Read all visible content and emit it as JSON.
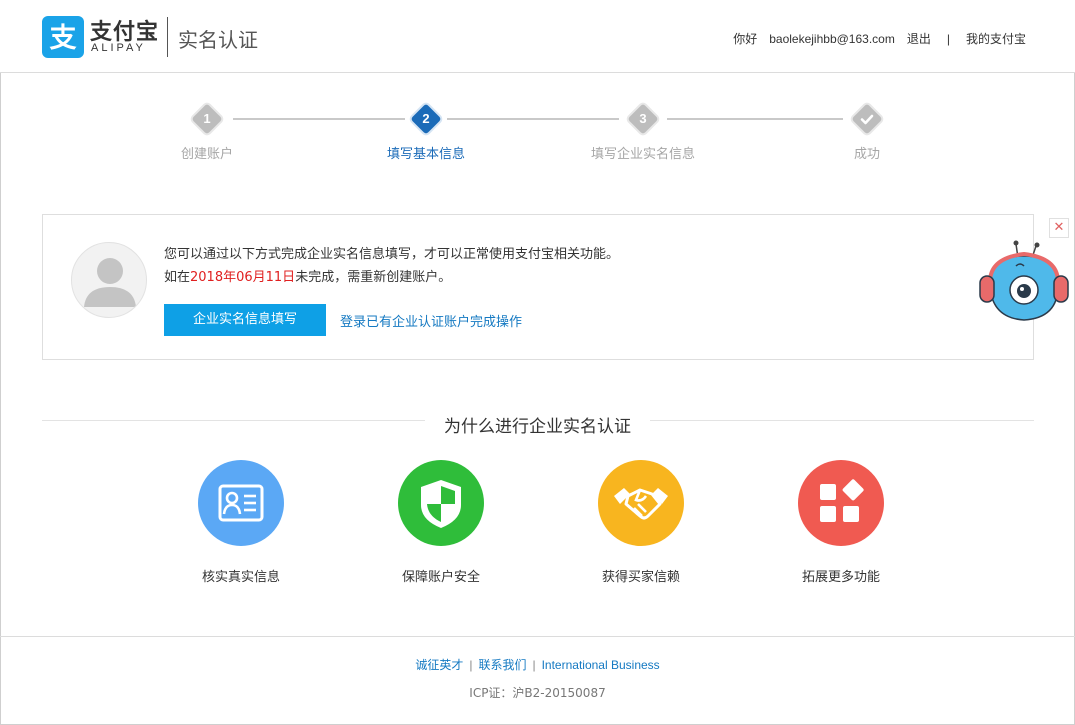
{
  "header": {
    "logo_text": "支付宝",
    "logo_sub": "ALIPAY",
    "title": "实名认证",
    "user": {
      "greeting": "你好",
      "email": "baolekejihbb@163.com",
      "logout": "退出",
      "separator": "|",
      "my_alipay": "我的支付宝"
    }
  },
  "steps": [
    {
      "num": "1",
      "label": "创建账户",
      "state": "done"
    },
    {
      "num": "2",
      "label": "填写基本信息",
      "state": "active"
    },
    {
      "num": "3",
      "label": "填写企业实名信息",
      "state": "pending"
    },
    {
      "num": "",
      "label": "成功",
      "state": "pending",
      "icon": "check-icon"
    }
  ],
  "notice": {
    "line1": "您可以通过以下方式完成企业实名信息填写，才可以正常使用支付宝相关功能。",
    "line2_prefix": "如在",
    "line2_date": "2018年06月11日",
    "line2_suffix": "未完成，需重新创建账户。",
    "primary_button": "企业实名信息填写",
    "secondary_link": "登录已有企业认证账户完成操作",
    "close_symbol": "✕"
  },
  "why": {
    "title": "为什么进行企业实名认证",
    "features": [
      {
        "label": "核实真实信息",
        "icon": "id-card-icon",
        "color": "#5ba8f5"
      },
      {
        "label": "保障账户安全",
        "icon": "shield-icon",
        "color": "#2fbd3a"
      },
      {
        "label": "获得买家信赖",
        "icon": "handshake-icon",
        "color": "#f8b51f"
      },
      {
        "label": "拓展更多功能",
        "icon": "apps-icon",
        "color": "#f05a51"
      }
    ]
  },
  "footer": {
    "links": [
      "诚征英才",
      "联系我们",
      "International Business"
    ],
    "separator": "|",
    "icp": "ICP证：沪B2-20150087"
  },
  "colors": {
    "brand": "#1aa3e8",
    "step_active": "#1b6bb8",
    "deadline": "#e02020",
    "link": "#1479c2",
    "button": "#0ea0e6"
  }
}
